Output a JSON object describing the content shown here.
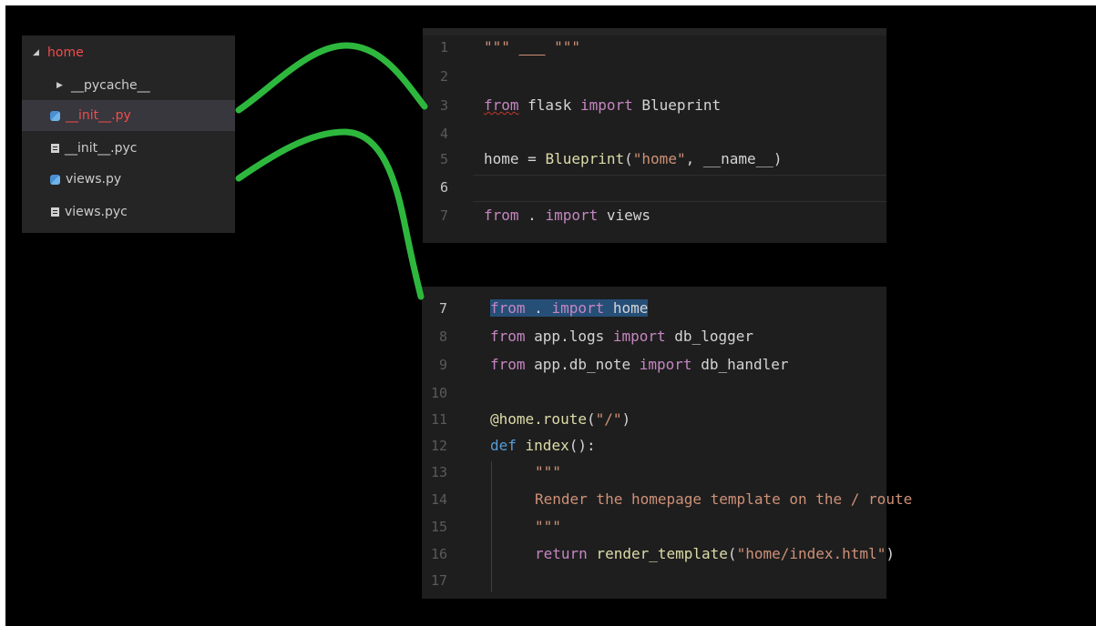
{
  "explorer": {
    "items": [
      {
        "label": "home",
        "type": "folder-open",
        "color": "#f14c4c"
      },
      {
        "label": "__pycache__",
        "type": "folder-closed"
      },
      {
        "label": "__init__.py",
        "type": "python-file",
        "selected": true,
        "color": "#f14c4c"
      },
      {
        "label": "__init__.pyc",
        "type": "compiled-file"
      },
      {
        "label": "views.py",
        "type": "python-file"
      },
      {
        "label": "views.pyc",
        "type": "compiled-file"
      }
    ]
  },
  "init_panel": {
    "line_numbers": [
      "1",
      "2",
      "3",
      "4",
      "5",
      "6",
      "7"
    ],
    "active_line": "6",
    "tokens": {
      "l1_open": "\"\"\"",
      "l1_blank": "___",
      "l1_close": "\"\"\"",
      "l3_from": "from",
      "l3_mod": " flask ",
      "l3_import": "import",
      "l3_name": " Blueprint",
      "l5_lhs": "home = ",
      "l5_fn": "Blueprint",
      "l5_open": "(",
      "l5_str": "\"home\"",
      "l5_rest": ", __name__)",
      "l7_from": "from",
      "l7_mod": " . ",
      "l7_import": "import",
      "l7_name": " views"
    }
  },
  "views_panel": {
    "line_numbers": [
      "7",
      "8",
      "9",
      "10",
      "11",
      "12",
      "13",
      "14",
      "15",
      "16",
      "17"
    ],
    "active_line": "7",
    "tokens": {
      "l7_from": "from",
      "l7_mod": " . ",
      "l7_import": "import",
      "l7_name": " home",
      "l8_from": "from",
      "l8_mod": " app.logs ",
      "l8_import": "import",
      "l8_name": " db_logger",
      "l9_from": "from",
      "l9_mod": " app.db_note ",
      "l9_import": "import",
      "l9_name": " db_handler",
      "l11_dec": "@home.route",
      "l11_open": "(",
      "l11_str": "\"/\"",
      "l11_close": ")",
      "l12_def": "def",
      "l12_fn": " index",
      "l12_rest": "():",
      "l13_doc": "\"\"\"",
      "l14_doc": "Render the homepage template on the / route",
      "l15_doc": "\"\"\"",
      "l16_return": "return",
      "l16_fn": " render_template",
      "l16_open": "(",
      "l16_str": "\"home/index.html\"",
      "l16_close": ")"
    }
  },
  "colors": {
    "keyword": "#c586c0",
    "def_keyword": "#569cd6",
    "string": "#ce9178",
    "function": "#dcdcaa",
    "annotation_arrow": "#2db83d"
  }
}
